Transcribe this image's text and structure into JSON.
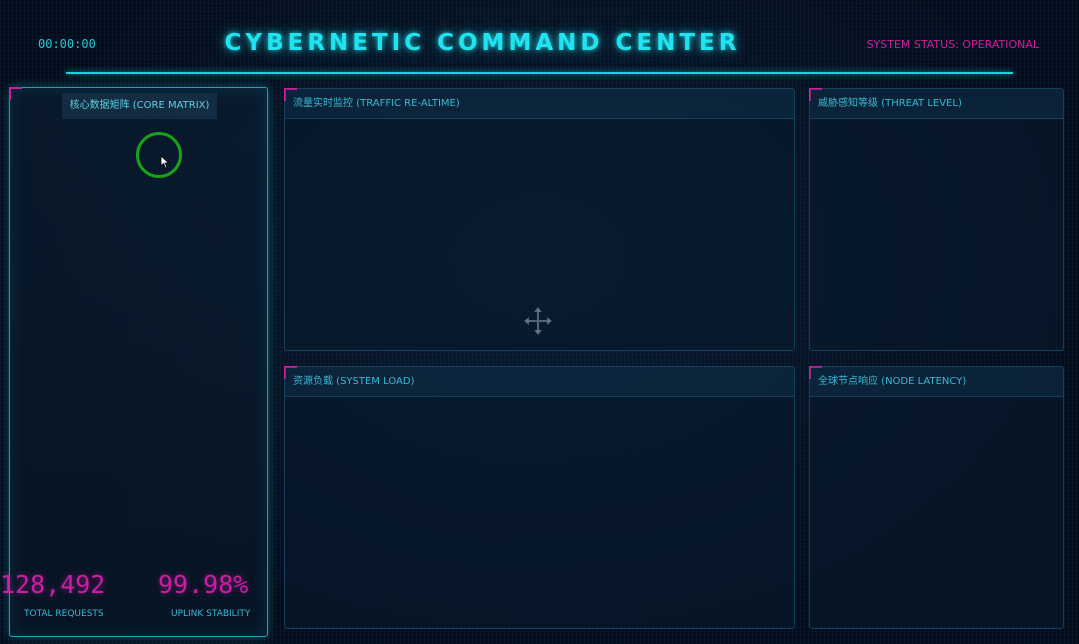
{
  "header": {
    "clock": "00:00:00",
    "title": "CYBERNETIC COMMAND CENTER",
    "status": "SYSTEM STATUS: OPERATIONAL"
  },
  "panels": {
    "core": {
      "title": "核心数据矩阵 (CORE MATRIX)",
      "stats": [
        {
          "value": "128,492",
          "label": "TOTAL REQUESTS"
        },
        {
          "value": "99.98%",
          "label": "UPLINK STABILITY"
        }
      ]
    },
    "traffic": {
      "title": "流量实时监控 (TRAFFIC RE-ALTIME)"
    },
    "threat": {
      "title": "威胁感知等级 (THREAT LEVEL)"
    },
    "load": {
      "title": "资源负载 (SYSTEM LOAD)"
    },
    "latency": {
      "title": "全球节点响应 (NODE LATENCY)"
    }
  },
  "icons": {
    "cursor": "arrow-cursor-icon",
    "move": "move-cross-icon",
    "loading": "loading-ring-icon"
  },
  "colors": {
    "accent": "#1fe3ef",
    "magenta": "#d01f9c",
    "ring": "#1aa01a"
  }
}
